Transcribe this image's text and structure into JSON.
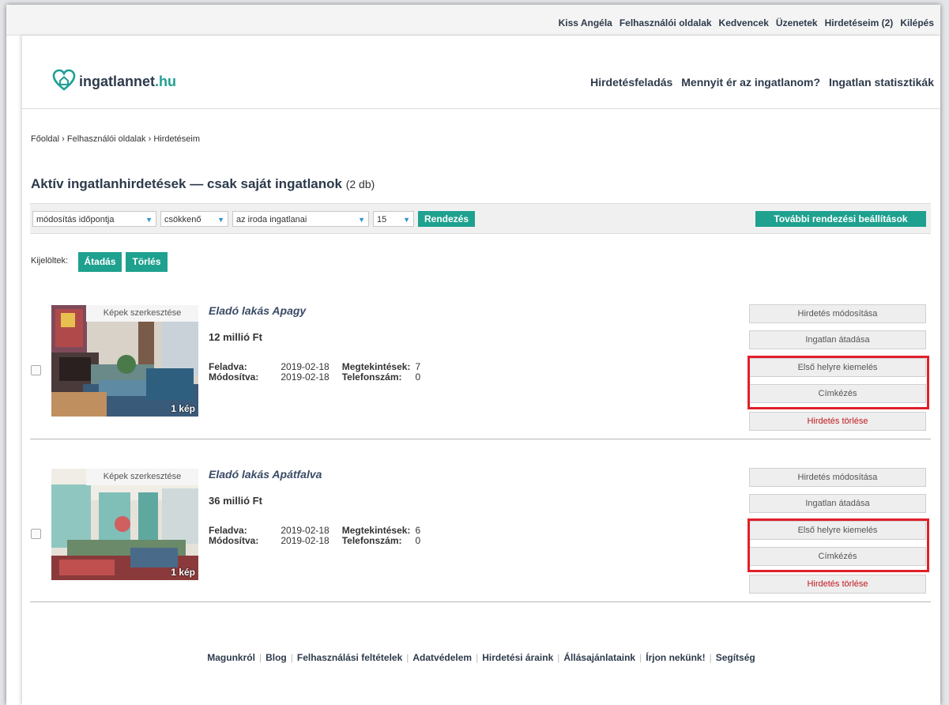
{
  "topnav": [
    "Kiss Angéla",
    "Felhasználói oldalak",
    "Kedvencek",
    "Üzenetek",
    "Hirdetéseim (2)",
    "Kilépés"
  ],
  "logo": {
    "name": "ingatlannet",
    "tld": ".hu",
    "icon": "house-heart-icon",
    "color": "#1f9f93"
  },
  "mainnav": [
    "Hirdetésfeladás",
    "Mennyit ér az ingatlanom?",
    "Ingatlan statisztikák"
  ],
  "breadcrumb": [
    "Főoldal",
    "Felhasználói oldalak",
    "Hirdetéseim"
  ],
  "page_title": {
    "text": "Aktív ingatlanhirdetések — csak saját ingatlanok",
    "count": "(2 db)"
  },
  "toolbar": {
    "sort_field": "módosítás időpontja",
    "sort_order": "csökkenő",
    "filter": "az iroda ingatlanai",
    "per_page": "15",
    "sort_button": "Rendezés",
    "more_settings": "További rendezési beállítások"
  },
  "bulk": {
    "label": "Kijelöltek:",
    "transfer": "Átadás",
    "delete": "Törlés"
  },
  "listing_labels": {
    "edit_photos": "Képek szerkesztése",
    "posted": "Feladva:",
    "modified": "Módosítva:",
    "views": "Megtekintések:",
    "phone": "Telefonszám:"
  },
  "listings": [
    {
      "title": "Eladó lakás Apagy",
      "price": "12 millió Ft",
      "posted": "2019-02-18",
      "modified": "2019-02-18",
      "views": "7",
      "phone_views": "0",
      "photo_count": "1 kép"
    },
    {
      "title": "Eladó lakás Apátfalva",
      "price": "36 millió Ft",
      "posted": "2019-02-18",
      "modified": "2019-02-18",
      "views": "6",
      "phone_views": "0",
      "photo_count": "1 kép"
    }
  ],
  "actions": {
    "edit": "Hirdetés módosítása",
    "transfer": "Ingatlan átadása",
    "promote": "Első helyre kiemelés",
    "tag": "Címkézés",
    "delete": "Hirdetés törlése"
  },
  "footer": [
    "Magunkról",
    "Blog",
    "Felhasználási feltételek",
    "Adatvédelem",
    "Hirdetési áraink",
    "Állásajánlataink",
    "Írjon nekünk!",
    "Segítség"
  ],
  "colors": {
    "accent": "#1fa18f",
    "nav": "#2d3a4b",
    "delete": "#c0181e",
    "highlight": "#e0202a"
  }
}
